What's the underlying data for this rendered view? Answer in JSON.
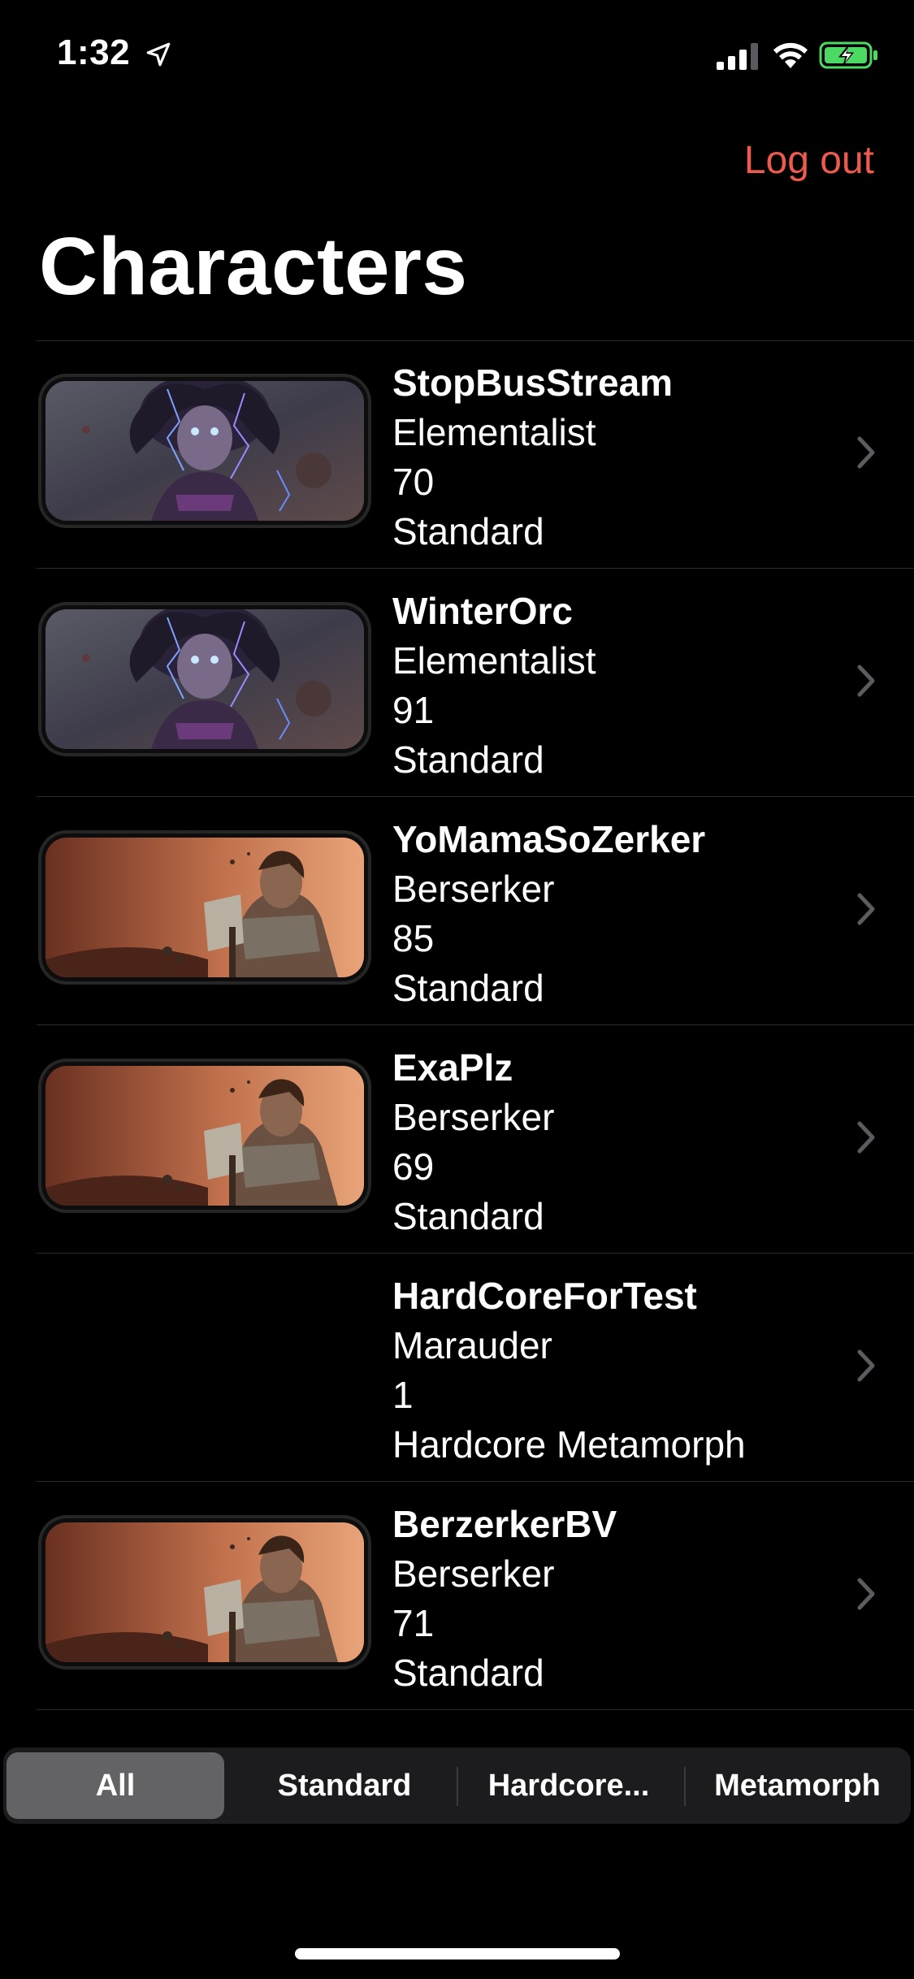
{
  "status_bar": {
    "time": "1:32",
    "icons": [
      "location-arrow-icon",
      "signal-bars-icon",
      "wifi-icon",
      "battery-charging-icon"
    ]
  },
  "header": {
    "logout_label": "Log out",
    "title": "Characters"
  },
  "characters": [
    {
      "name": "StopBusStream",
      "class": "Elementalist",
      "level": "70",
      "league": "Standard",
      "portrait": "elementalist"
    },
    {
      "name": "WinterOrc",
      "class": "Elementalist",
      "level": "91",
      "league": "Standard",
      "portrait": "elementalist"
    },
    {
      "name": "YoMamaSoZerker",
      "class": "Berserker",
      "level": "85",
      "league": "Standard",
      "portrait": "berserker"
    },
    {
      "name": "ExaPlz",
      "class": "Berserker",
      "level": "69",
      "league": "Standard",
      "portrait": "berserker"
    },
    {
      "name": "HardCoreForTest",
      "class": "Marauder",
      "level": "1",
      "league": "Hardcore Metamorph",
      "portrait": ""
    },
    {
      "name": "BerzerkerBV",
      "class": "Berserker",
      "level": "71",
      "league": "Standard",
      "portrait": "berserker"
    }
  ],
  "filter": {
    "segments": [
      "All",
      "Standard",
      "Hardcore...",
      "Metamorph"
    ],
    "selected": "All"
  },
  "colors": {
    "accent": "#ec5b4d",
    "background": "#000000",
    "segment_selected": "#636366",
    "battery_charging": "#4cd964"
  }
}
